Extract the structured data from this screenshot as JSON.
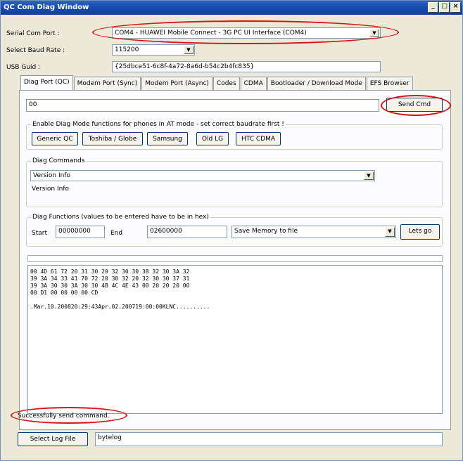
{
  "window": {
    "title": "QC Com Diag Window",
    "controls": [
      "_",
      "□",
      "×"
    ]
  },
  "form": {
    "serial_label": "Serial Com Port :",
    "serial_value": "COM4 - HUAWEI Mobile Connect - 3G PC UI Interface (COM4)",
    "baud_label": "Select Baud Rate :",
    "baud_value": "115200",
    "usb_label": "USB Guid :",
    "usb_value": "{25dbce51-6c8f-4a72-8a6d-b54c2b4fc835}"
  },
  "tabs": [
    "Diag Port (QC)",
    "Modem Port (Sync)",
    "Modem Port (Async)",
    "Codes",
    "CDMA",
    "Bootloader / Download Mode",
    "EFS Browser"
  ],
  "diag": {
    "command_value": "00",
    "send_label": "Send Cmd",
    "at_mode_title": "Enable Diag Mode functions for phones in AT mode - set correct baudrate first !",
    "phone_buttons": [
      "Generic QC",
      "Toshiba / Globe",
      "Samsung",
      "Old LG",
      "HTC CDMA"
    ],
    "commands_title": "Diag Commands",
    "commands_selected": "Version Info",
    "commands_result": "Version Info",
    "functions_title": "Diag Functions (values to be entered have to be in hex)",
    "start_label": "Start",
    "start_value": "00000000",
    "end_label": "End",
    "end_value": "02600000",
    "function_selected": "Save Memory to file",
    "go_label": "Lets go"
  },
  "output_lines": [
    "00 4D 61 72 20 31 30 20 32 30 30 38 32 30 3A 32",
    "39 3A 34 33 41 70 72 20 30 32 20 32 30 30 37 31",
    "39 3A 30 30 3A 30 30 4B 4C 4E 43 00 20 20 20 00",
    "00 D1 00 00 00 00 CD",
    "",
    ".Mar.10.200820:29:43Apr.02.200719:00:00KLNC.........."
  ],
  "status": "Successfully send command.",
  "log": {
    "button_label": "Select Log File",
    "value": "bytelog"
  },
  "colors": {
    "title_bar": "#1b4fb4",
    "annotation_ring": "#d81313"
  }
}
